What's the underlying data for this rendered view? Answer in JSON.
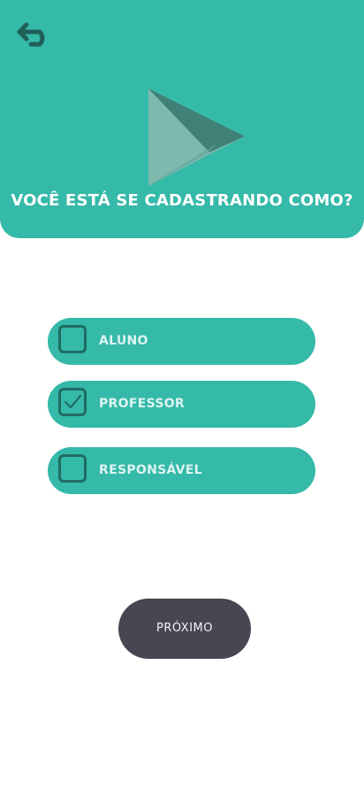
{
  "header": {
    "back_icon": "undo-arrow-icon",
    "logo_icon": "play-triangle-logo",
    "title": "VOCÊ ESTÁ SE CADASTRANDO COMO?"
  },
  "options": [
    {
      "label": "ALUNO",
      "checked": false
    },
    {
      "label": "PROFESSOR",
      "checked": true
    },
    {
      "label": "RESPONSÁVEL",
      "checked": false
    }
  ],
  "next_button": {
    "label": "PRÓXIMO"
  },
  "colors": {
    "primary": "#35b9a8",
    "checkbox_border": "#1f6d63",
    "button_dark": "#4a4552",
    "background": "#ffffff"
  }
}
